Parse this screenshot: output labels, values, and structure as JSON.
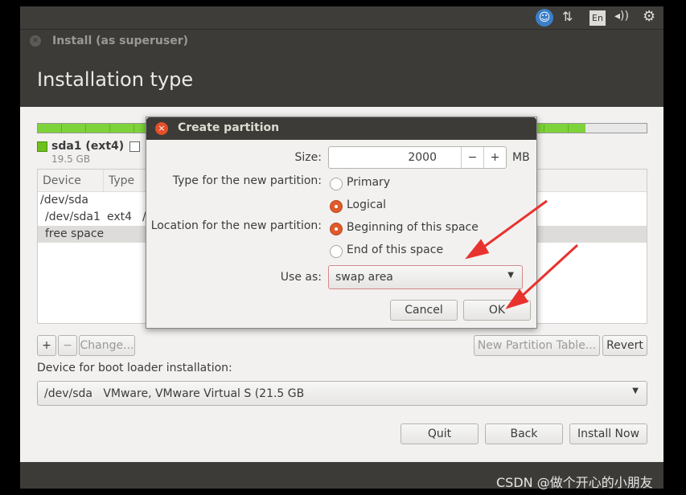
{
  "panel": {
    "icons": [
      "accessibility-icon",
      "network-icon",
      "keyboard-layout-icon",
      "volume-icon",
      "power-gear-icon"
    ],
    "keyboard": "En"
  },
  "window": {
    "title": "Install (as superuser)",
    "heading": "Installation type"
  },
  "partitions": {
    "legend": [
      {
        "name": "sda1 (ext4)",
        "size": "19.5 GB",
        "color": "#6ec01c"
      }
    ],
    "usage_fraction": 0.9,
    "columns": [
      "Device",
      "Type"
    ],
    "rows": [
      {
        "device": "/dev/sda",
        "type": ""
      },
      {
        "device": "/dev/sda1",
        "type": "ext4",
        "extra": "/"
      },
      {
        "device": "free space",
        "type": ""
      }
    ]
  },
  "controls": {
    "add": "+",
    "remove": "−",
    "change": "Change...",
    "new_table": "New Partition Table...",
    "revert": "Revert"
  },
  "bootloader": {
    "label": "Device for boot loader installation:",
    "value": "/dev/sda   VMware, VMware Virtual S (21.5 GB"
  },
  "buttons": {
    "quit": "Quit",
    "back": "Back",
    "install": "Install Now"
  },
  "dialog": {
    "title": "Create partition",
    "size_label": "Size:",
    "size_value": "2000",
    "minus": "−",
    "plus": "+",
    "unit": "MB",
    "type_label": "Type for the new partition:",
    "type_options": [
      "Primary",
      "Logical"
    ],
    "type_selected": "Logical",
    "location_label": "Location for the new partition:",
    "location_options": [
      "Beginning of this space",
      "End of this space"
    ],
    "location_selected": "Beginning of this space",
    "use_as_label": "Use as:",
    "use_as_value": "swap area",
    "cancel": "Cancel",
    "ok": "OK"
  },
  "watermark": "CSDN @做个开心的小朋友"
}
